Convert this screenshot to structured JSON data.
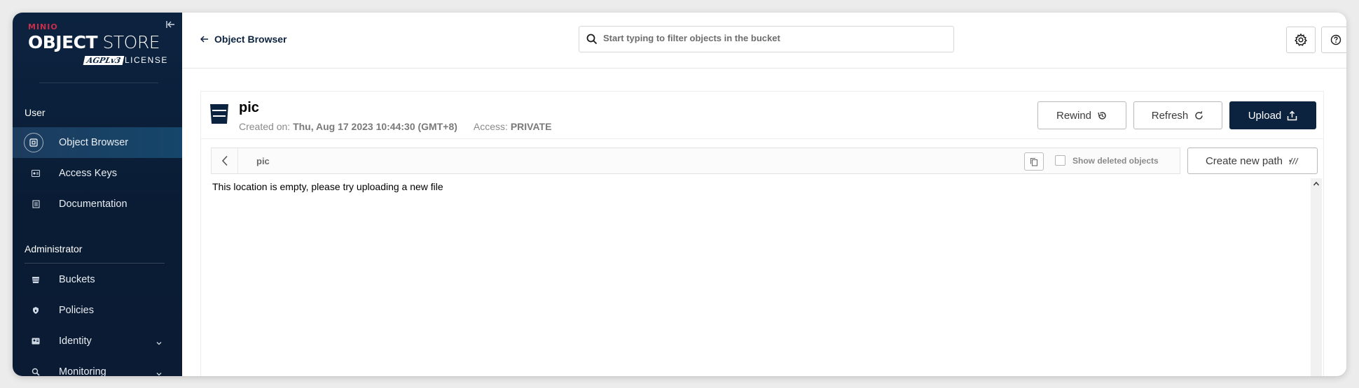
{
  "sidebar": {
    "logo": {
      "brand": "MINIO",
      "title_bold": "OBJECT",
      "title_light": " STORE",
      "badge": "AGPLv3",
      "license": "LICENSE"
    },
    "sections": [
      {
        "title": "User"
      },
      {
        "title": "Administrator"
      }
    ],
    "items": [
      {
        "label": "Object Browser",
        "icon": "object-browser-icon",
        "active": true
      },
      {
        "label": "Access Keys",
        "icon": "access-keys-icon"
      },
      {
        "label": "Documentation",
        "icon": "documentation-icon"
      },
      {
        "label": "Buckets",
        "icon": "buckets-icon"
      },
      {
        "label": "Policies",
        "icon": "policies-icon"
      },
      {
        "label": "Identity",
        "icon": "identity-icon",
        "expandable": true
      },
      {
        "label": "Monitoring",
        "icon": "monitoring-icon",
        "expandable": true
      }
    ]
  },
  "header": {
    "back_label": "Object Browser",
    "search_placeholder": "Start typing to filter objects in the bucket"
  },
  "bucket": {
    "name": "pic",
    "created_label": "Created on:",
    "created_value": "Thu, Aug 17 2023 10:44:30 (GMT+8)",
    "access_label": "Access:",
    "access_value": "PRIVATE"
  },
  "actions": {
    "rewind": "Rewind",
    "refresh": "Refresh",
    "upload": "Upload",
    "create_path": "Create new path"
  },
  "path": {
    "current": "pic",
    "show_deleted_label": "Show deleted objects",
    "show_deleted_checked": false
  },
  "content": {
    "empty_message": "This location is empty, please try uploading a new file"
  },
  "colors": {
    "sidebar_bg": "#0c2340",
    "active_item": "#15466b",
    "brand_red": "#c72e49",
    "primary": "#0c2340"
  }
}
